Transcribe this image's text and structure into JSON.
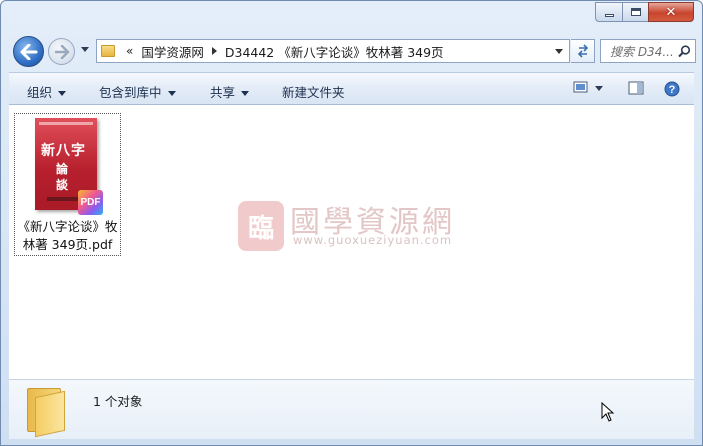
{
  "window": {
    "caption": {
      "minimize": "minimize",
      "maximize": "maximize",
      "close": "close"
    }
  },
  "nav": {
    "back_icon": "back-arrow-icon",
    "forward_icon": "forward-arrow-icon",
    "overflow": "«",
    "breadcrumbs": [
      "国学资源网",
      "D34442 《新八字论谈》牧林著 349页"
    ],
    "search_placeholder": "搜索 D34..."
  },
  "toolbar": {
    "organize": "组织",
    "include_in_library": "包含到库中",
    "share": "共享",
    "new_folder": "新建文件夹"
  },
  "files": [
    {
      "name": "《新八字论谈》牧林著 349页.pdf",
      "cover_title_1": "新八字",
      "cover_title_2": "論",
      "cover_title_3": "談",
      "badge": "PDF"
    }
  ],
  "watermark": {
    "seal": "臨",
    "title": "國學資源網",
    "url": "www.guoxueziyuan.com"
  },
  "status": {
    "count": "1 个对象"
  },
  "colors": {
    "accent": "#2f6fc5",
    "cover_red": "#b8202e"
  }
}
